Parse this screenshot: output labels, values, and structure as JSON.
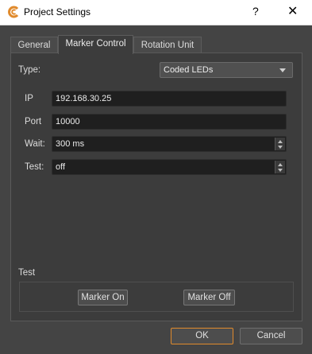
{
  "window": {
    "title": "Project Settings",
    "help_label": "?",
    "close_label": "✕",
    "icon": "c-logo-icon",
    "accent_color": "#e08a2c"
  },
  "tabs": [
    {
      "label": "General",
      "active": false
    },
    {
      "label": "Marker Control",
      "active": true
    },
    {
      "label": "Rotation Unit",
      "active": false
    }
  ],
  "type": {
    "label": "Type:",
    "value": "Coded LEDs"
  },
  "fields": {
    "ip": {
      "label": "IP",
      "value": "192.168.30.25"
    },
    "port": {
      "label": "Port",
      "value": "10000"
    },
    "wait": {
      "label": "Wait:",
      "value": "300 ms"
    },
    "test": {
      "label": "Test:",
      "value": "off"
    }
  },
  "test_group": {
    "title": "Test",
    "marker_on_label": "Marker On",
    "marker_off_label": "Marker Off"
  },
  "footer": {
    "ok_label": "OK",
    "cancel_label": "Cancel"
  }
}
